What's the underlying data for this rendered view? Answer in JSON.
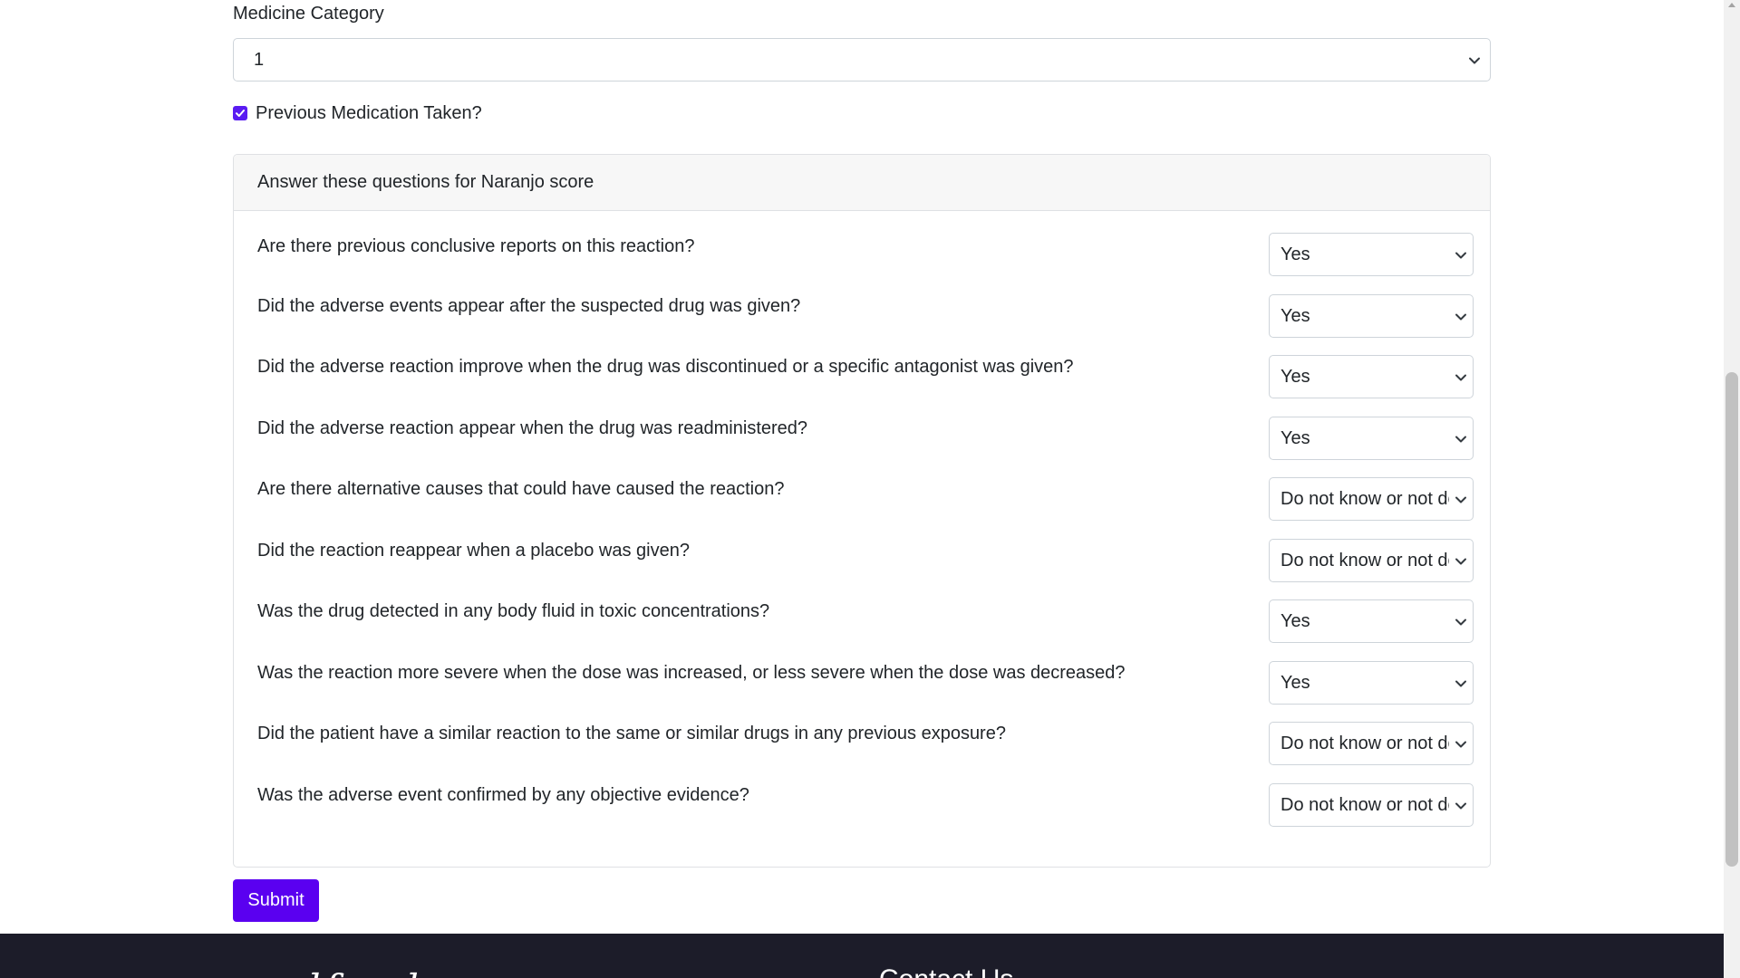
{
  "form": {
    "medicine_category_label": "Medicine Category",
    "medicine_category_value": "1",
    "previous_medication_label": "Previous Medication Taken?",
    "previous_medication_checked": true
  },
  "naranjo": {
    "header": "Answer these questions for Naranjo score",
    "questions": [
      {
        "text": "Are there previous conclusive reports on this reaction?",
        "answer": "Yes"
      },
      {
        "text": "Did the adverse events appear after the suspected drug was given?",
        "answer": "Yes"
      },
      {
        "text": "Did the adverse reaction improve when the drug was discontinued or a specific antagonist was given?",
        "answer": "Yes"
      },
      {
        "text": "Did the adverse reaction appear when the drug was readministered?",
        "answer": "Yes"
      },
      {
        "text": "Are there alternative causes that could have caused the reaction?",
        "answer": "Do not know or not done"
      },
      {
        "text": "Did the reaction reappear when a placebo was given?",
        "answer": "Do not know or not done"
      },
      {
        "text": "Was the drug detected in any body fluid in toxic concentrations?",
        "answer": "Yes"
      },
      {
        "text": "Was the reaction more severe when the dose was increased, or less severe when the dose was decreased?",
        "answer": "Yes"
      },
      {
        "text": "Did the patient have a similar reaction to the same or similar drugs in any previous exposure?",
        "answer": "Do not know or not done"
      },
      {
        "text": "Was the adverse event confirmed by any objective evidence?",
        "answer": "Do not know or not done"
      }
    ]
  },
  "submit_label": "Submit",
  "footer": {
    "logo_text": "medfeed",
    "contact_heading": "Contact Us"
  },
  "colors": {
    "accent": "#5a00f0",
    "footer_bg": "#1c1c29"
  }
}
